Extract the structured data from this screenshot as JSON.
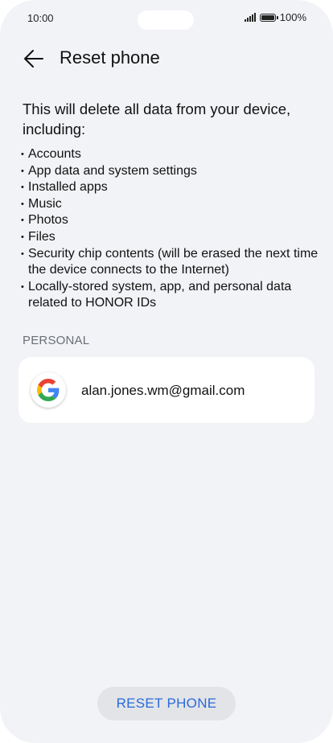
{
  "status_bar": {
    "time": "10:00",
    "battery": "100%"
  },
  "header": {
    "title": "Reset phone"
  },
  "content": {
    "intro": "This will delete all data from your device, including:",
    "bullets": [
      "Accounts",
      "App data and system settings",
      "Installed apps",
      "Music",
      "Photos",
      "Files",
      "Security chip contents (will be erased the next time the device connects to the Internet)",
      "Locally-stored system, app, and personal data related to HONOR IDs"
    ],
    "section_label": "PERSONAL",
    "account": {
      "email": "alan.jones.wm@gmail.com",
      "icon": "google-icon"
    }
  },
  "footer": {
    "reset_label": "RESET PHONE"
  },
  "colors": {
    "background": "#f1f3f6",
    "accent": "#2a6bd9",
    "card": "#ffffff"
  }
}
